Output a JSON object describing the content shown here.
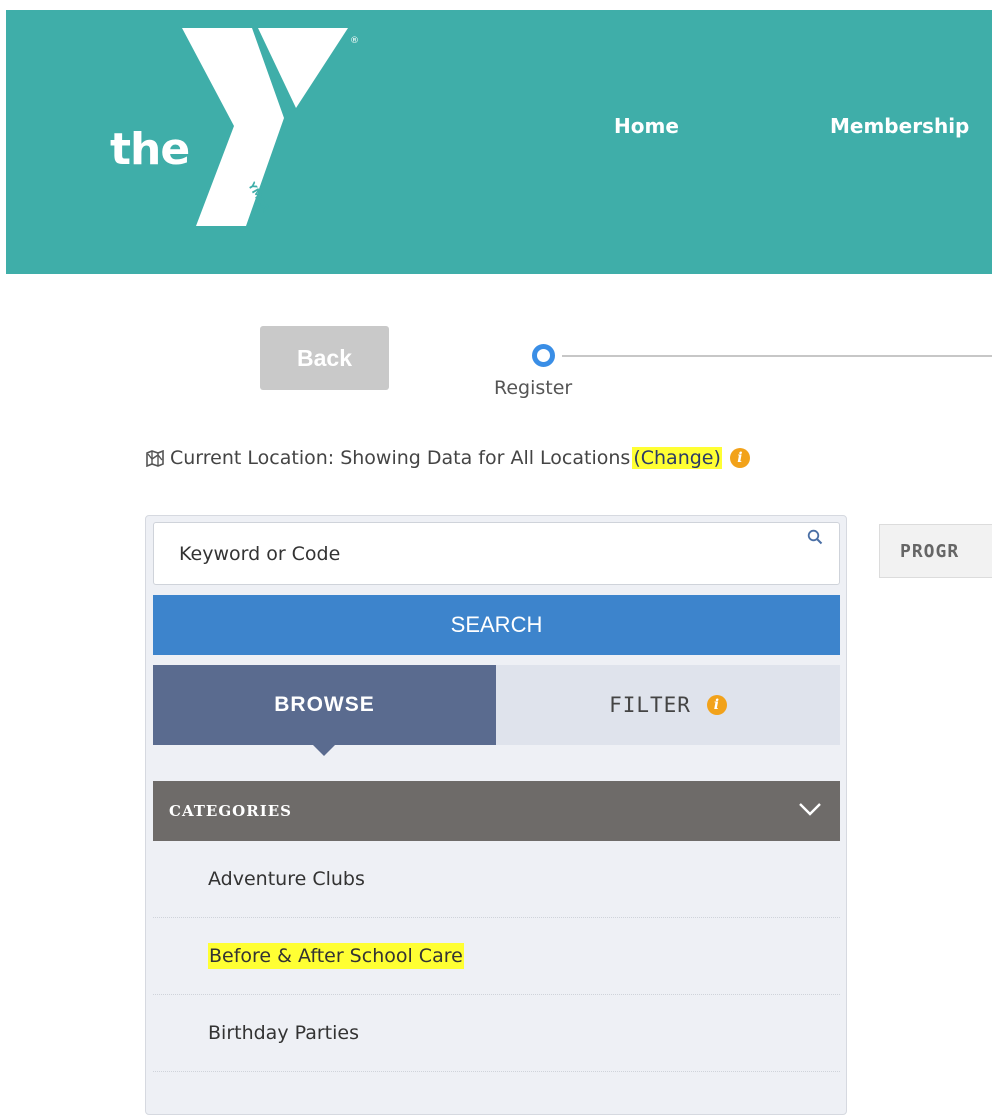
{
  "header": {
    "logo_text": "the",
    "logo_sub": "YMCA",
    "logo_mark": "®",
    "nav": [
      {
        "label": "Home"
      },
      {
        "label": "Membership"
      }
    ],
    "background_color": "#3faea9"
  },
  "progress": {
    "back_label": "Back",
    "step_label": "Register",
    "accent_color": "#3a8ee6"
  },
  "location": {
    "icon": "map-icon",
    "text": "Current Location: Showing Data for All Locations",
    "change_label": "(Change)",
    "info_icon": "info-icon",
    "highlight_color": "#ffff33"
  },
  "search": {
    "placeholder": "Keyword or Code",
    "button_label": "SEARCH",
    "button_color": "#3d84cc"
  },
  "tabs": {
    "browse_label": "BROWSE",
    "filter_label": "FILTER",
    "active": "BROWSE"
  },
  "categories": {
    "header": "CATEGORIES",
    "items": [
      {
        "label": "Adventure Clubs"
      },
      {
        "label": "Before & After School Care"
      },
      {
        "label": "Birthday Parties"
      }
    ]
  },
  "results": {
    "tab_label": "PROGR"
  }
}
